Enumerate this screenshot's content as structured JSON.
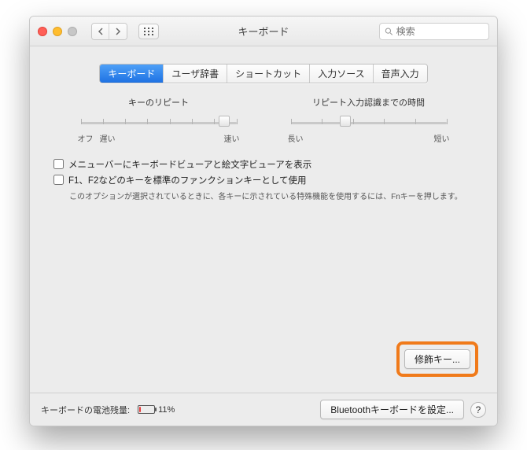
{
  "window": {
    "title": "キーボード"
  },
  "search": {
    "placeholder": "検索"
  },
  "tabs": [
    {
      "label": "キーボード",
      "active": true
    },
    {
      "label": "ユーザ辞書"
    },
    {
      "label": "ショートカット"
    },
    {
      "label": "入力ソース"
    },
    {
      "label": "音声入力"
    }
  ],
  "sliders": {
    "repeat": {
      "title": "キーのリピート",
      "left1": "オフ",
      "left2": "遅い",
      "right": "速い",
      "ticks": 8,
      "value_pct": 92
    },
    "delay": {
      "title": "リピート入力認識までの時間",
      "left": "長い",
      "right": "短い",
      "ticks": 6,
      "value_pct": 35
    }
  },
  "checkboxes": {
    "show_viewer": "メニューバーにキーボードビューアと絵文字ビューアを表示",
    "fn_keys": "F1、F2などのキーを標準のファンクションキーとして使用",
    "fn_hint": "このオプションが選択されているときに、各キーに示されている特殊機能を使用するには、Fnキーを押します。"
  },
  "buttons": {
    "modifier": "修飾キー...",
    "bluetooth": "Bluetoothキーボードを設定...",
    "help": "?"
  },
  "battery": {
    "label": "キーボードの電池残量:",
    "pct_text": "11%",
    "pct": 11
  }
}
